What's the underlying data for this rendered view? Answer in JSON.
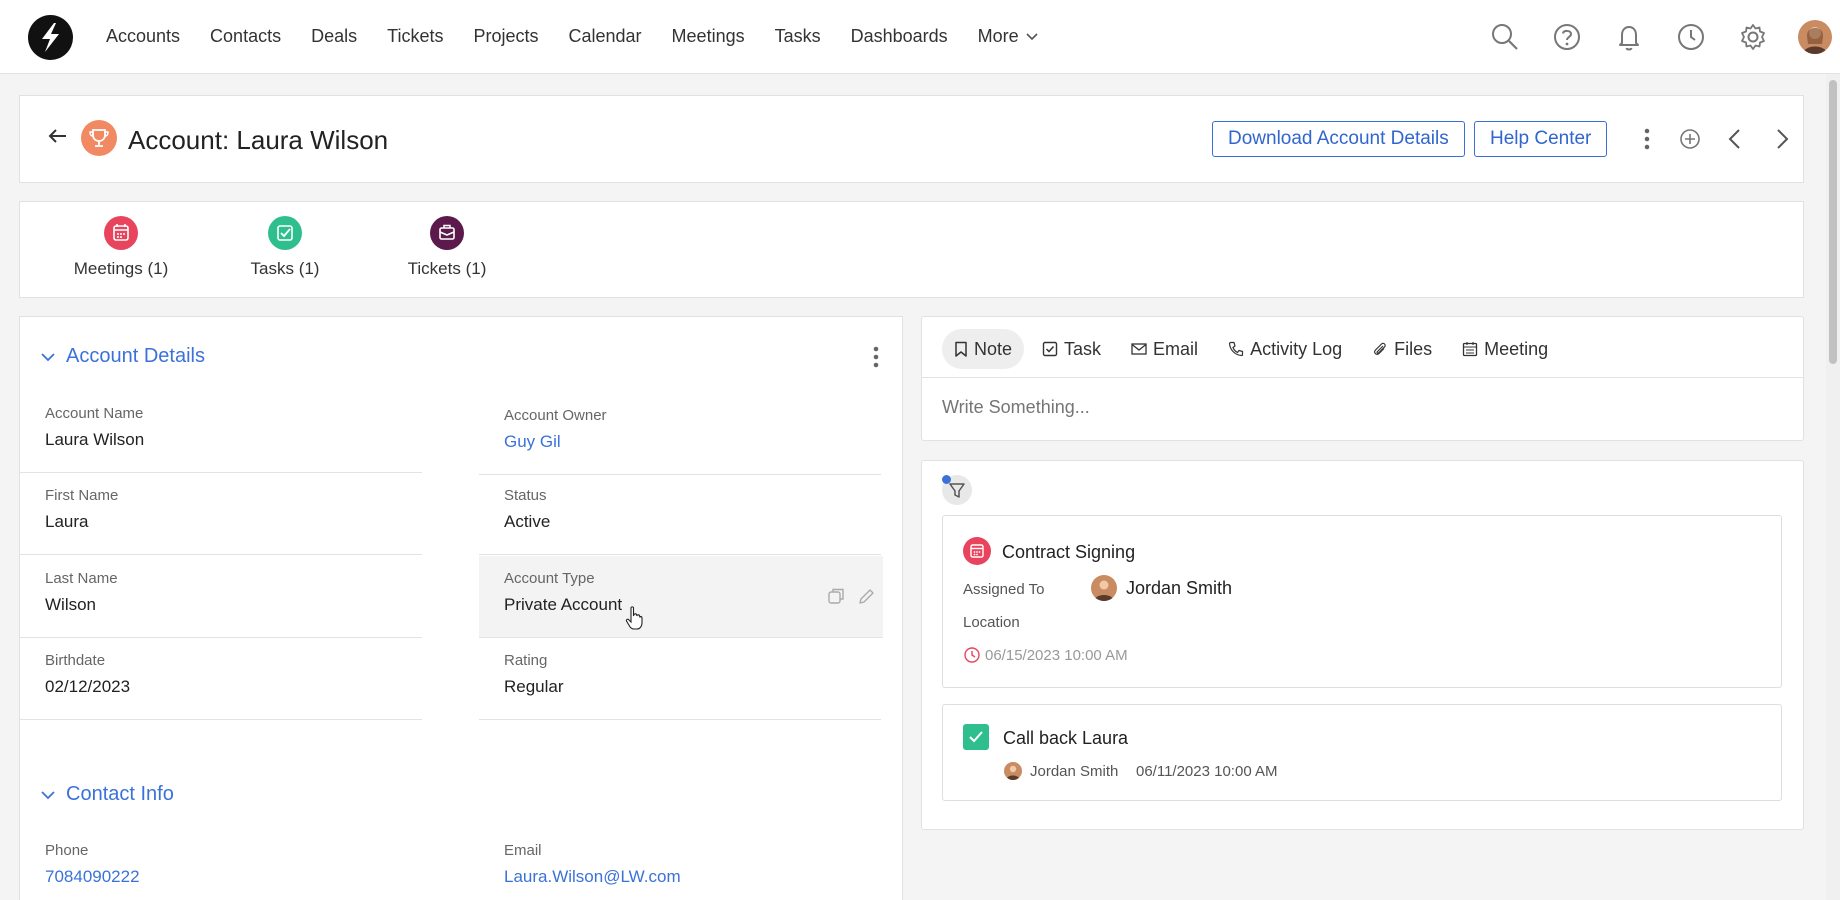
{
  "nav": {
    "items": [
      "Accounts",
      "Contacts",
      "Deals",
      "Tickets",
      "Projects",
      "Calendar",
      "Meetings",
      "Tasks",
      "Dashboards"
    ],
    "more_label": "More",
    "icons": [
      "search-icon",
      "help-icon",
      "bell-icon",
      "clock-icon",
      "gear-icon",
      "user-avatar"
    ]
  },
  "header": {
    "title": "Account: Laura Wilson",
    "download_label": "Download Account Details",
    "help_label": "Help Center"
  },
  "related": [
    {
      "label": "Meetings (1)",
      "color": "#e8445e",
      "icon": "calendar-icon"
    },
    {
      "label": "Tasks (1)",
      "color": "#2fbf8f",
      "icon": "checkbox-icon"
    },
    {
      "label": "Tickets (1)",
      "color": "#5b1a4b",
      "icon": "ticket-icon"
    }
  ],
  "account_details": {
    "title": "Account Details",
    "fields": [
      {
        "label": "Account Name",
        "value": "Laura Wilson"
      },
      {
        "label": "Account Owner",
        "value": "Guy Gil"
      },
      {
        "label": "First Name",
        "value": "Laura"
      },
      {
        "label": "Status",
        "value": "Active"
      },
      {
        "label": "Last Name",
        "value": "Wilson"
      },
      {
        "label": "Account Type",
        "value": "Private Account"
      },
      {
        "label": "Birthdate",
        "value": "02/12/2023"
      },
      {
        "label": "Rating",
        "value": "Regular"
      }
    ]
  },
  "contact_info": {
    "title": "Contact Info",
    "fields": [
      {
        "label": "Phone",
        "value": "7084090222"
      },
      {
        "label": "Email",
        "value": "Laura.Wilson@LW.com"
      }
    ]
  },
  "composer": {
    "tabs": [
      "Note",
      "Task",
      "Email",
      "Activity Log",
      "Files",
      "Meeting"
    ],
    "placeholder": "Write Something..."
  },
  "timeline": {
    "meeting": {
      "title": "Contract Signing",
      "assigned_label": "Assigned To",
      "assignee": "Jordan Smith",
      "location_label": "Location",
      "datetime": "06/15/2023 10:00 AM"
    },
    "task": {
      "title": "Call back Laura",
      "assignee": "Jordan Smith",
      "datetime": "06/11/2023 10:00 AM"
    }
  },
  "colors": {
    "accent": "#3b72d9",
    "meeting_red": "#e8445e",
    "task_green": "#2fbf8f"
  }
}
